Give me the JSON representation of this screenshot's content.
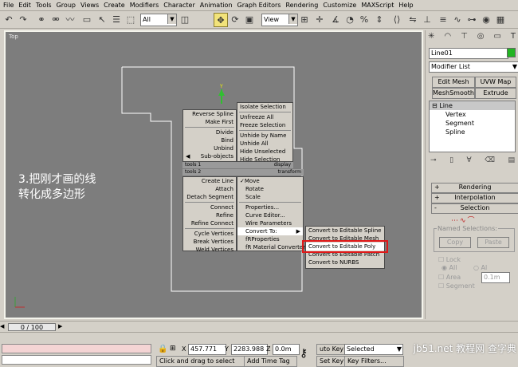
{
  "menu": [
    "File",
    "Edit",
    "Tools",
    "Group",
    "Views",
    "Create",
    "Modifiers",
    "Character",
    "Animation",
    "Graph Editors",
    "Rendering",
    "Customize",
    "MAXScript",
    "Help"
  ],
  "toolbar": {
    "selection_filter": "All",
    "coord_system": "View"
  },
  "viewport": {
    "label": "Top",
    "annotation_line1": "3.把刚才画的线",
    "annotation_line2": "转化成多边形"
  },
  "quad_left_top": [
    "Reverse Spline",
    "Make First",
    "Divide",
    "Bind",
    "Unbind",
    "Sub-objects"
  ],
  "quad_left_top_header": {
    "left": "tools 1",
    "right": "display"
  },
  "quad_right_top": [
    "Isolate Selection",
    "Unfreeze All",
    "Freeze Selection",
    "Unhide by Name",
    "Unhide All",
    "Hide Unselected",
    "Hide Selection"
  ],
  "quad_header2": {
    "left": "tools 2",
    "right": "transform"
  },
  "quad_left_bottom": [
    "Create Line",
    "Attach",
    "Detach Segment",
    "Connect",
    "Refine",
    "Refine Connect",
    "Cycle Vertices",
    "Break Vertices",
    "Weld Vertices"
  ],
  "quad_right_bottom": [
    "Move",
    "Rotate",
    "Scale",
    "Properties...",
    "Curve Editor...",
    "Wire Parameters",
    "Convert To:",
    "fRProperties",
    "fR Material Converter"
  ],
  "convert_submenu": [
    "Convert to Editable Spline",
    "Convert to Editable Mesh",
    "Convert to Editable Poly",
    "Convert to Editable Patch",
    "Convert to NURBS"
  ],
  "panel": {
    "object_name": "Line01",
    "modifier_list": "Modifier List",
    "buttons": [
      "Edit Mesh",
      "UVW Map",
      "MeshSmooth",
      "Extrude"
    ],
    "stack": [
      "Line",
      "Vertex",
      "Segment",
      "Spline"
    ],
    "rollouts": [
      {
        "sign": "+",
        "label": "Rendering"
      },
      {
        "sign": "+",
        "label": "Interpolation"
      },
      {
        "sign": "-",
        "label": "Selection"
      }
    ],
    "named_selections": "Named Selections:",
    "copy": "Copy",
    "paste": "Paste",
    "lock": "Lock",
    "all_h": "All",
    "all_v": "Al",
    "area": "Area",
    "area_val": "0.1m",
    "segment": "Segment"
  },
  "timeline": {
    "frame": "0 / 100"
  },
  "status": {
    "x_label": "X",
    "x_val": "457.771",
    "y_label": "Y",
    "y_val": "2283.988",
    "z_label": "Z",
    "z_val": "0.0m",
    "prompt": "Click and drag to select",
    "add_time_tag": "Add Time Tag",
    "auto_key": "uto Key",
    "selected": "Selected",
    "set_key": "Set Key",
    "key_filters": "Key Filters..."
  },
  "watermark": "jb51.net 教程网 查字典"
}
